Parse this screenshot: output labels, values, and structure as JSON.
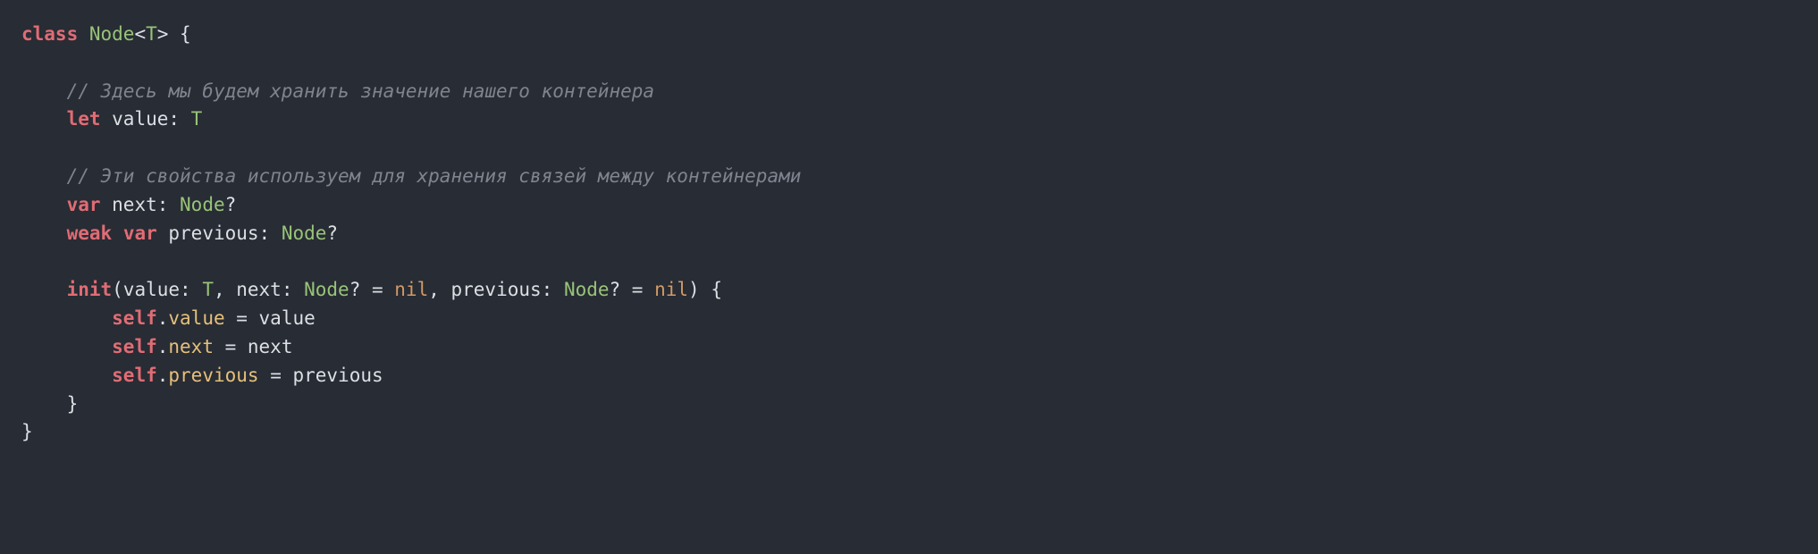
{
  "code": {
    "lines": [
      {
        "tokens": [
          {
            "cls": "kw",
            "t": "class"
          },
          {
            "cls": "punc",
            "t": " "
          },
          {
            "cls": "type",
            "t": "Node"
          },
          {
            "cls": "punc",
            "t": "<"
          },
          {
            "cls": "type",
            "t": "T"
          },
          {
            "cls": "punc",
            "t": "> {"
          }
        ]
      },
      {
        "tokens": [
          {
            "cls": "punc",
            "t": ""
          }
        ]
      },
      {
        "tokens": [
          {
            "cls": "punc",
            "t": "    "
          },
          {
            "cls": "cmt",
            "t": "// Здесь мы будем хранить значение нашего контейнера"
          }
        ]
      },
      {
        "tokens": [
          {
            "cls": "punc",
            "t": "    "
          },
          {
            "cls": "kw",
            "t": "let"
          },
          {
            "cls": "punc",
            "t": " value: "
          },
          {
            "cls": "type",
            "t": "T"
          }
        ]
      },
      {
        "tokens": [
          {
            "cls": "punc",
            "t": ""
          }
        ]
      },
      {
        "tokens": [
          {
            "cls": "punc",
            "t": "    "
          },
          {
            "cls": "cmt",
            "t": "// Эти свойства используем для хранения связей между контейнерами"
          }
        ]
      },
      {
        "tokens": [
          {
            "cls": "punc",
            "t": "    "
          },
          {
            "cls": "kw",
            "t": "var"
          },
          {
            "cls": "punc",
            "t": " next: "
          },
          {
            "cls": "type",
            "t": "Node"
          },
          {
            "cls": "punc",
            "t": "?"
          }
        ]
      },
      {
        "tokens": [
          {
            "cls": "punc",
            "t": "    "
          },
          {
            "cls": "kw",
            "t": "weak"
          },
          {
            "cls": "punc",
            "t": " "
          },
          {
            "cls": "kw",
            "t": "var"
          },
          {
            "cls": "punc",
            "t": " previous: "
          },
          {
            "cls": "type",
            "t": "Node"
          },
          {
            "cls": "punc",
            "t": "?"
          }
        ]
      },
      {
        "tokens": [
          {
            "cls": "punc",
            "t": ""
          }
        ]
      },
      {
        "tokens": [
          {
            "cls": "punc",
            "t": "    "
          },
          {
            "cls": "kw",
            "t": "init"
          },
          {
            "cls": "punc",
            "t": "(value: "
          },
          {
            "cls": "type",
            "t": "T"
          },
          {
            "cls": "punc",
            "t": ", next: "
          },
          {
            "cls": "type",
            "t": "Node"
          },
          {
            "cls": "punc",
            "t": "? = "
          },
          {
            "cls": "lit",
            "t": "nil"
          },
          {
            "cls": "punc",
            "t": ", previous: "
          },
          {
            "cls": "type",
            "t": "Node"
          },
          {
            "cls": "punc",
            "t": "? = "
          },
          {
            "cls": "lit",
            "t": "nil"
          },
          {
            "cls": "punc",
            "t": ") {"
          }
        ]
      },
      {
        "tokens": [
          {
            "cls": "punc",
            "t": "        "
          },
          {
            "cls": "kw",
            "t": "self"
          },
          {
            "cls": "punc",
            "t": "."
          },
          {
            "cls": "id",
            "t": "value"
          },
          {
            "cls": "punc",
            "t": " = value"
          }
        ]
      },
      {
        "tokens": [
          {
            "cls": "punc",
            "t": "        "
          },
          {
            "cls": "kw",
            "t": "self"
          },
          {
            "cls": "punc",
            "t": "."
          },
          {
            "cls": "id",
            "t": "next"
          },
          {
            "cls": "punc",
            "t": " = next"
          }
        ]
      },
      {
        "tokens": [
          {
            "cls": "punc",
            "t": "        "
          },
          {
            "cls": "kw",
            "t": "self"
          },
          {
            "cls": "punc",
            "t": "."
          },
          {
            "cls": "id",
            "t": "previous"
          },
          {
            "cls": "punc",
            "t": " = previous"
          }
        ]
      },
      {
        "tokens": [
          {
            "cls": "punc",
            "t": "    }"
          }
        ]
      },
      {
        "tokens": [
          {
            "cls": "punc",
            "t": "}"
          }
        ]
      }
    ]
  }
}
